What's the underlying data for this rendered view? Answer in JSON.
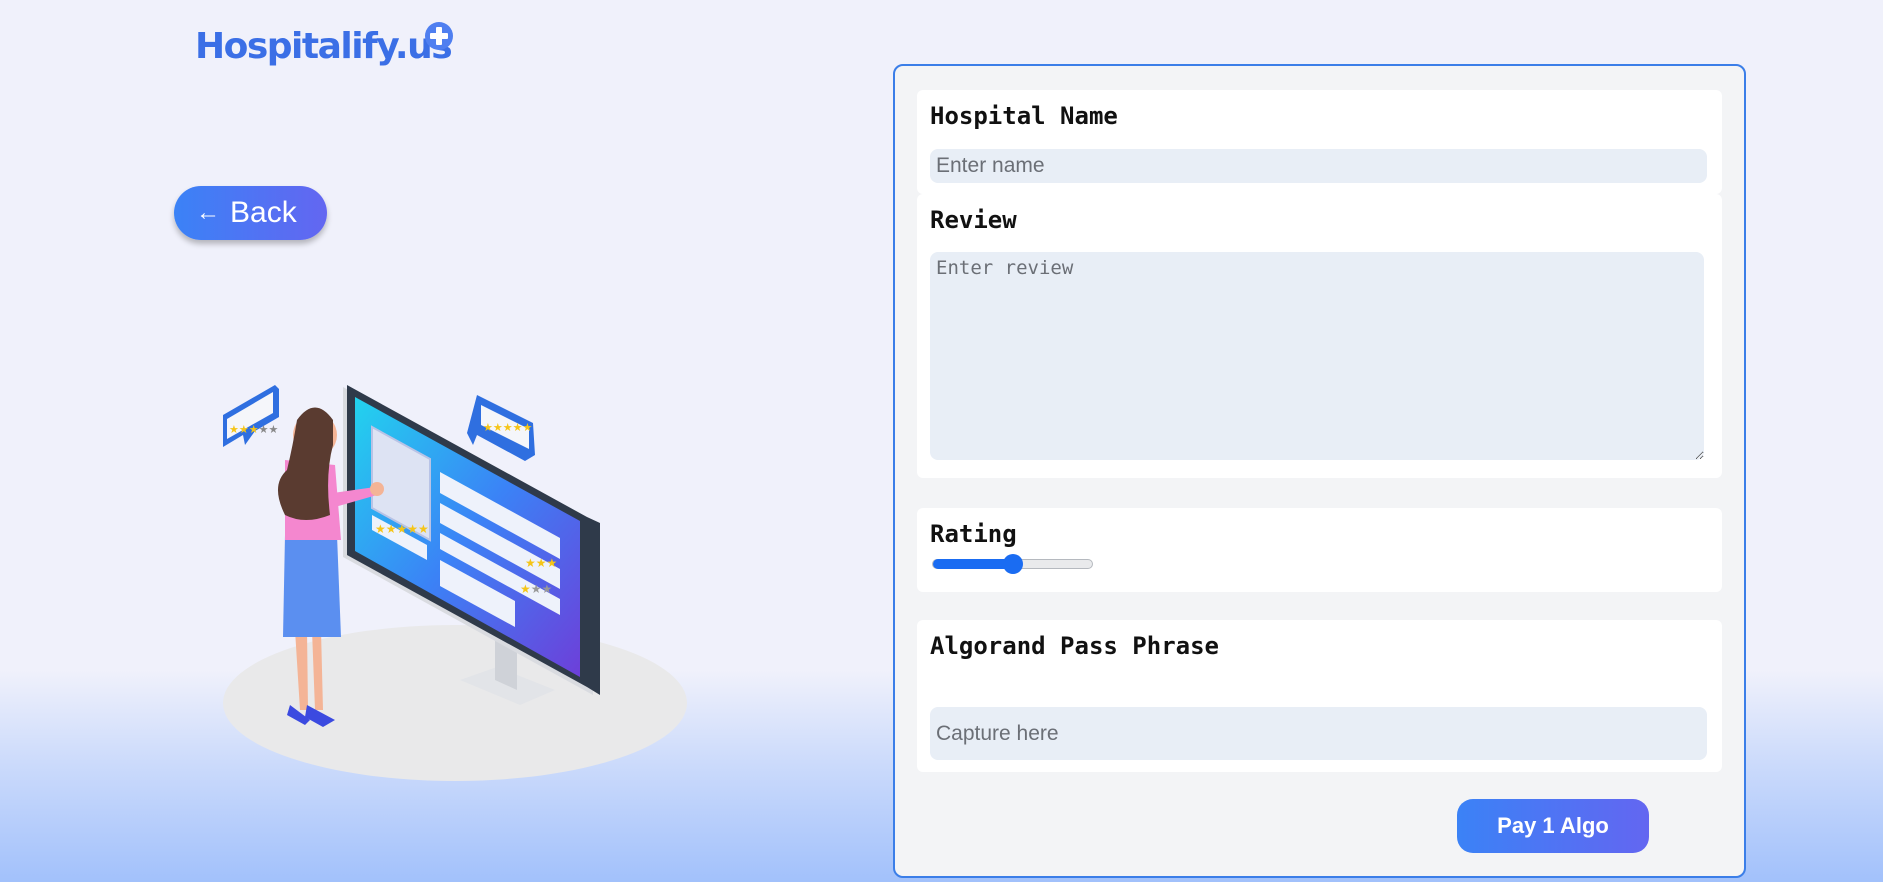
{
  "brand": {
    "name": "Hospitalify.us",
    "badge_icon": "medical-cross-icon",
    "color": "#3b6fe6"
  },
  "navigation": {
    "back_label": "Back",
    "back_icon": "arrow-left-icon"
  },
  "illustration": {
    "subject": "woman reviewing ratings on a monitor",
    "icons": [
      "star-rating-bubble-icon",
      "monitor-icon"
    ]
  },
  "form": {
    "hospital_name": {
      "label": "Hospital Name",
      "placeholder": "Enter name",
      "value": ""
    },
    "review": {
      "label": "Review",
      "placeholder": "Enter review",
      "value": ""
    },
    "rating": {
      "label": "Rating",
      "fraction": 0.5
    },
    "passphrase": {
      "label": "Algorand Pass Phrase",
      "placeholder": "Capture here",
      "value": ""
    },
    "submit_label": "Pay 1 Algo"
  },
  "colors": {
    "accent_start": "#3b82f6",
    "accent_end": "#6366f1",
    "panel_border": "#3b7ee8",
    "slider": "#1a6cf2"
  }
}
